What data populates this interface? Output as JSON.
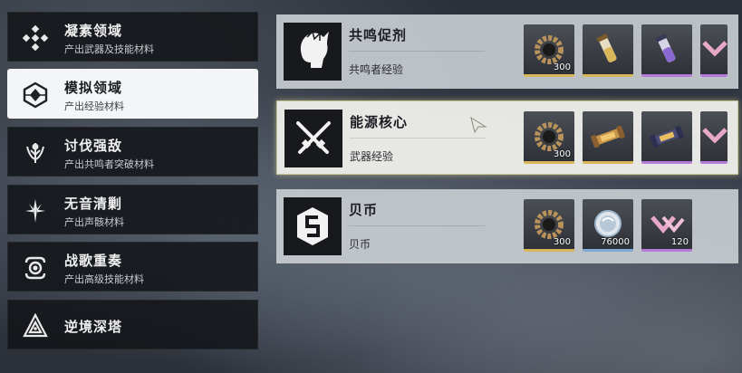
{
  "sidebar": {
    "items": [
      {
        "title": "凝素领域",
        "subtitle": "产出武器及技能材料",
        "icon": "diamond-cross-icon",
        "active": false
      },
      {
        "title": "模拟领域",
        "subtitle": "产出经验材料",
        "icon": "hexagon-gem-icon",
        "active": true
      },
      {
        "title": "讨伐强敌",
        "subtitle": "产出共鸣者突破材料",
        "icon": "crest-icon",
        "active": false
      },
      {
        "title": "无音清剿",
        "subtitle": "产出声骸材料",
        "icon": "star-burst-icon",
        "active": false
      },
      {
        "title": "战歌重奏",
        "subtitle": "产出高级技能材料",
        "icon": "eye-ring-icon",
        "active": false
      },
      {
        "title": "逆境深塔",
        "subtitle": "",
        "icon": "triangle-tower-icon",
        "active": false
      }
    ]
  },
  "domains": [
    {
      "name": "共鸣促剂",
      "desc": "共鸣者经验",
      "icon": "character-head-icon",
      "rewards": [
        {
          "icon": "gear-ring-icon",
          "qty": "300",
          "rarity": "gold"
        },
        {
          "icon": "tonic-vial-gold-icon",
          "qty": "",
          "rarity": "gold"
        },
        {
          "icon": "tonic-vial-purple-icon",
          "qty": "",
          "rarity": "purple"
        },
        {
          "icon": "shell-credit-icon",
          "qty": "",
          "rarity": "purple"
        }
      ]
    },
    {
      "name": "能源核心",
      "desc": "武器经验",
      "icon": "crossed-swords-icon",
      "active": true,
      "rewards": [
        {
          "icon": "gear-ring-icon",
          "qty": "300",
          "rarity": "gold"
        },
        {
          "icon": "energy-core-gold-icon",
          "qty": "",
          "rarity": "gold"
        },
        {
          "icon": "energy-core-purple-icon",
          "qty": "",
          "rarity": "purple"
        },
        {
          "icon": "shell-credit-icon",
          "qty": "",
          "rarity": "purple"
        }
      ]
    },
    {
      "name": "贝币",
      "desc": "贝币",
      "icon": "shell-coin-icon",
      "rewards": [
        {
          "icon": "gear-ring-icon",
          "qty": "300",
          "rarity": "gold"
        },
        {
          "icon": "shell-coin-reward-icon",
          "qty": "76000",
          "rarity": "blue"
        },
        {
          "icon": "shell-credit-icon",
          "qty": "120",
          "rarity": "purple"
        }
      ]
    }
  ]
}
